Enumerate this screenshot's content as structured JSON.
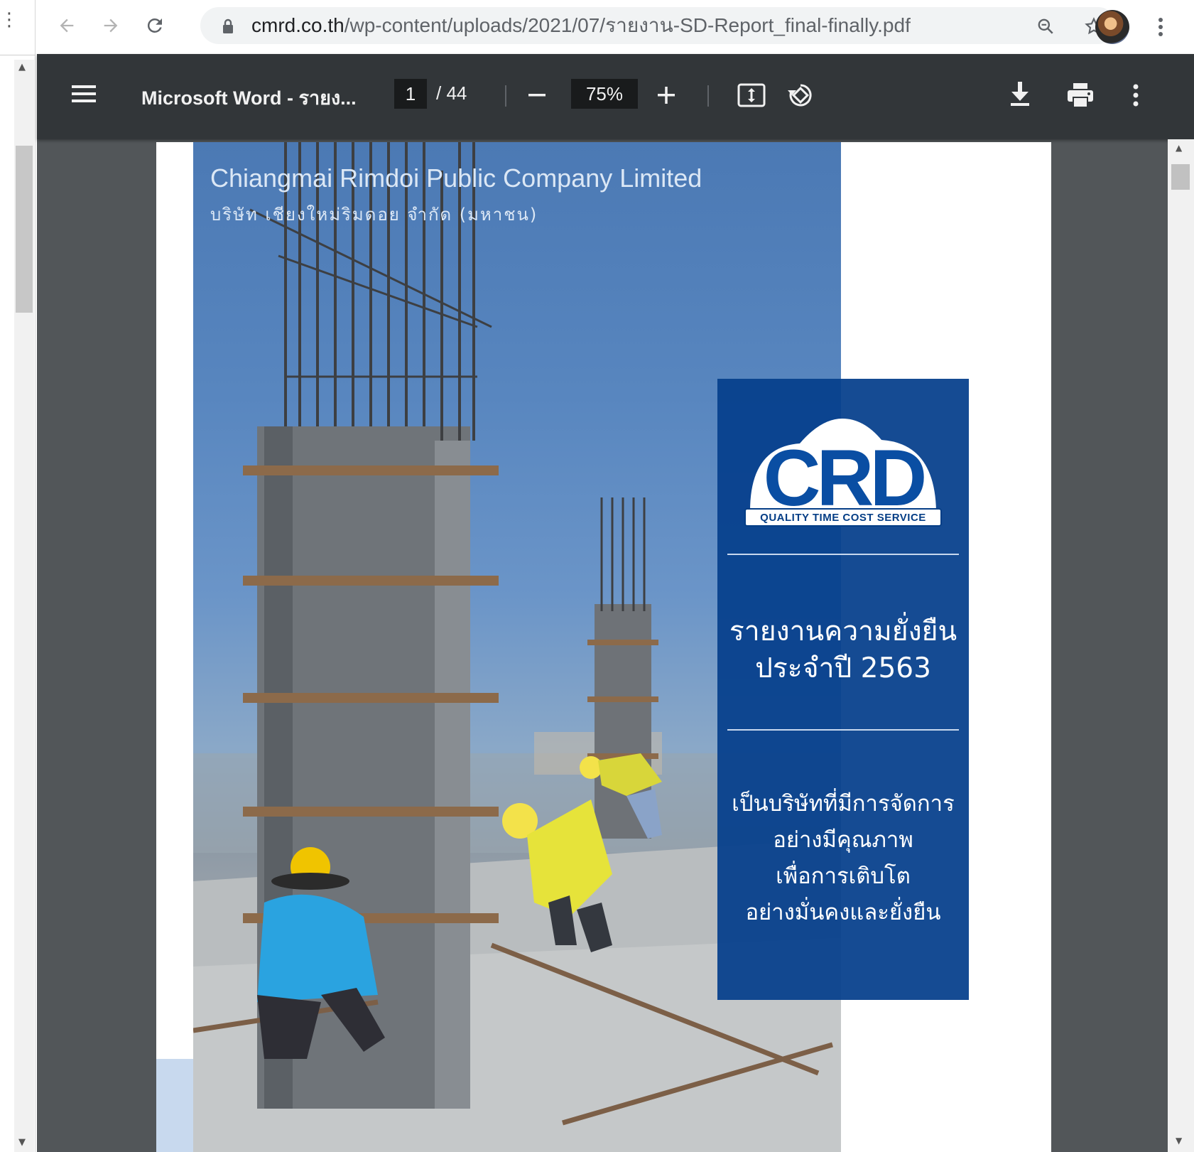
{
  "browser": {
    "url_host": "cmrd.co.th",
    "url_path": "/wp-content/uploads/2021/07/รายงาน-SD-Report_final-finally.pdf",
    "icons": {
      "back": "arrow-left-icon",
      "forward": "arrow-right-icon",
      "reload": "reload-icon",
      "lock": "lock-icon",
      "zoom": "zoom-icon",
      "bookmark": "star-icon",
      "profile": "avatar",
      "menu": "kebab-icon"
    }
  },
  "pdf_toolbar": {
    "title": "Microsoft Word - รายง...",
    "current_page": "1",
    "page_total": "/ 44",
    "zoom": "75%",
    "icons": [
      "menu-icon",
      "zoom-out-icon",
      "zoom-in-icon",
      "fit-page-icon",
      "rotate-icon",
      "download-icon",
      "print-icon",
      "more-icon"
    ]
  },
  "page": {
    "company_en": "Chiangmai Rimdoi Public Company Limited",
    "company_th": "บริษัท เชียงใหม่ริมดอย จำกัด (มหาชน)",
    "logo_text": "CRD",
    "logo_tagline": "QUALITY TIME COST SERVICE",
    "report_title": [
      "รายงานความยั่งยืน",
      "ประจำปี 2563"
    ],
    "slogan": [
      "เป็นบริษัทที่มีการจัดการ",
      "อย่างมีคุณภาพ",
      "เพื่อการเติบโต",
      "อย่างมั่นคงและยั่งยืน"
    ]
  },
  "colors": {
    "toolbar": "#323639",
    "viewer_background": "#525659",
    "panel_blue": "#06408c",
    "sky_blue": "#4b79b4"
  }
}
